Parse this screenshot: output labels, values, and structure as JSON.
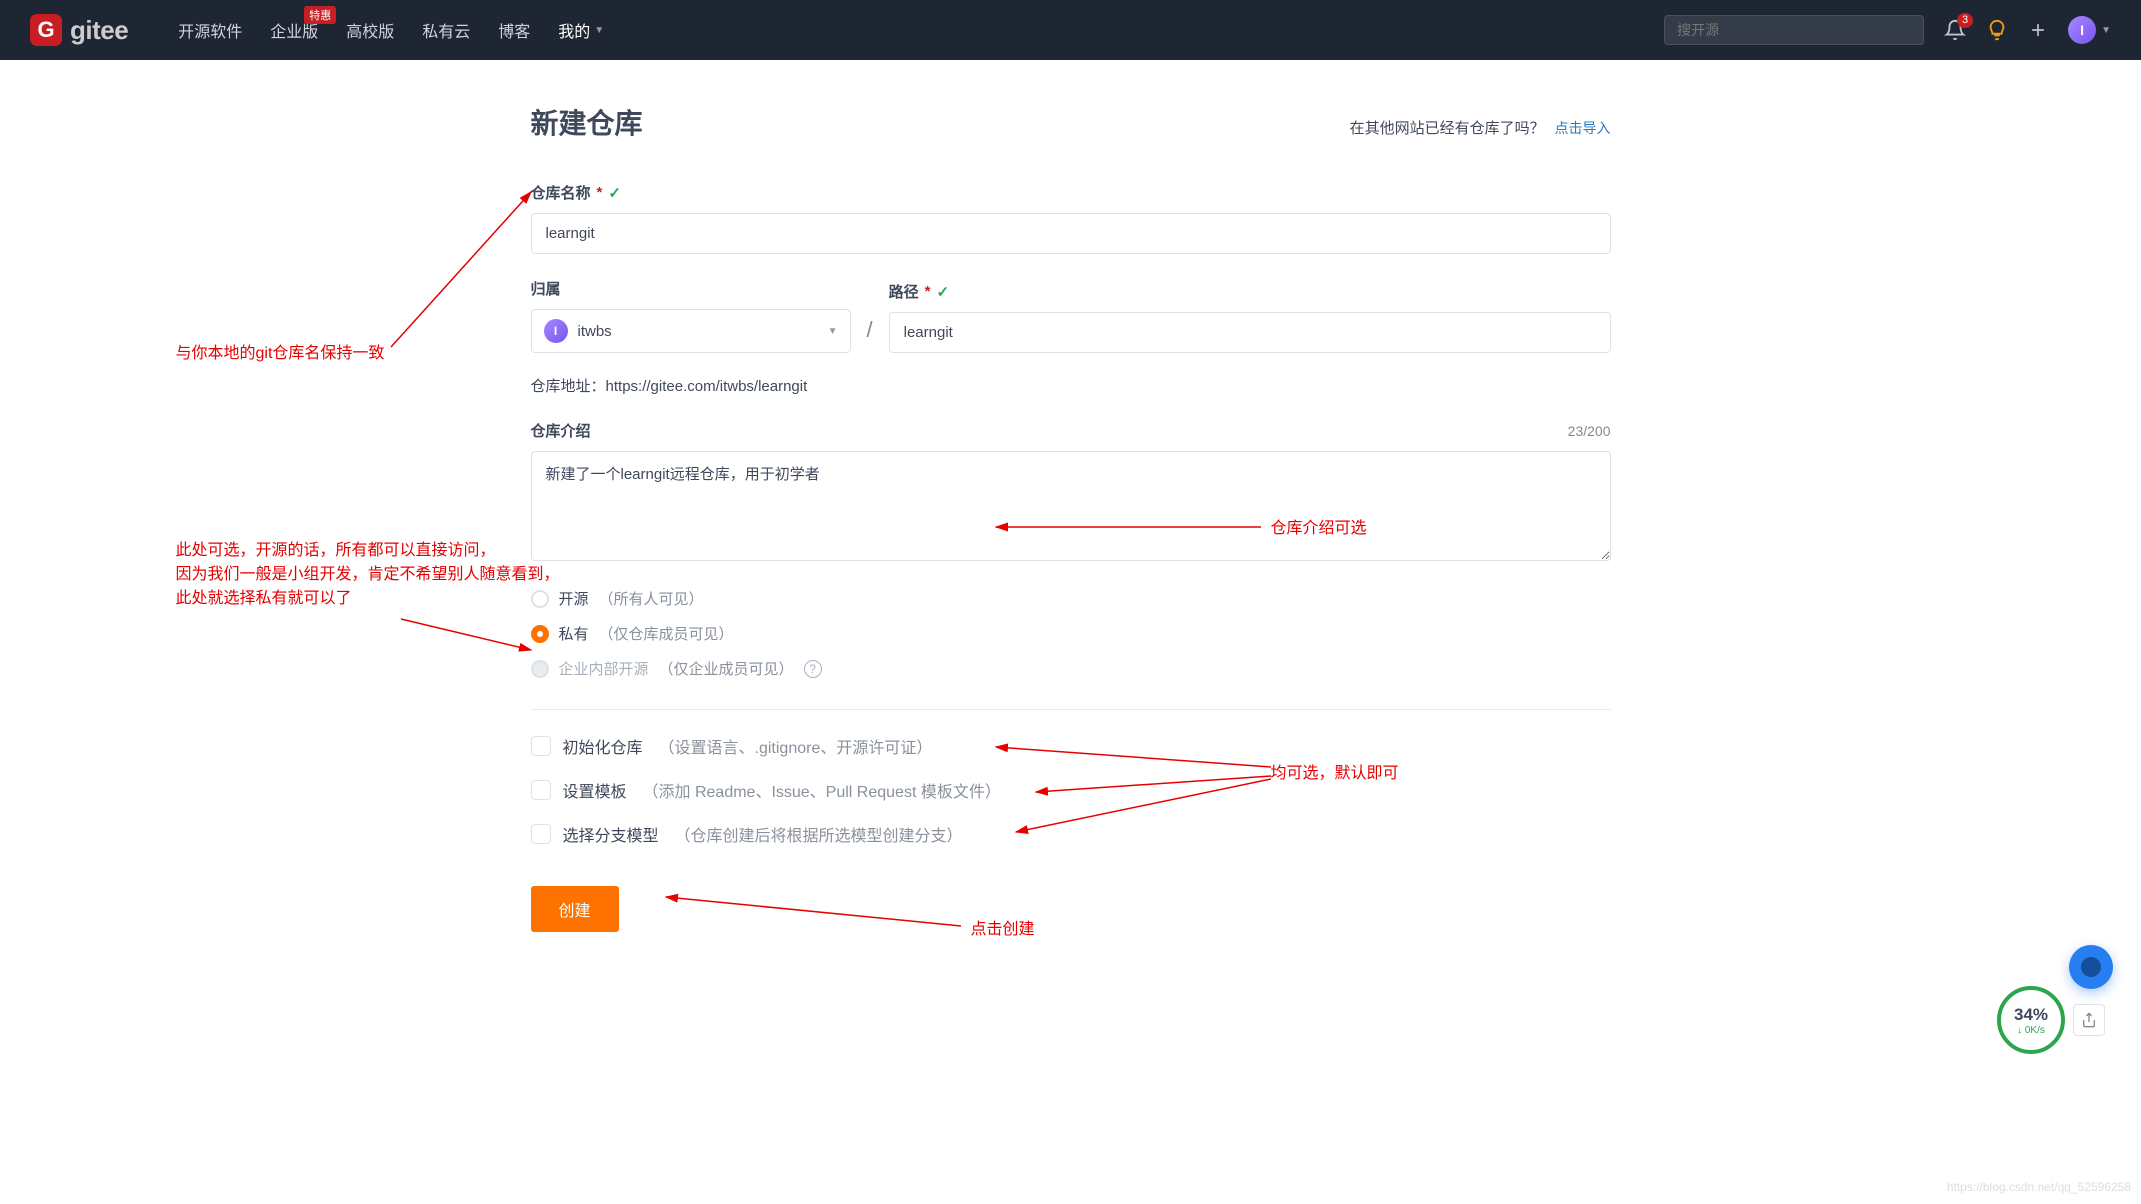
{
  "header": {
    "logo_text": "gitee",
    "nav": {
      "opensource": "开源软件",
      "enterprise": "企业版",
      "enterprise_badge": "特惠",
      "campus": "高校版",
      "private_cloud": "私有云",
      "blog": "博客",
      "mine": "我的"
    },
    "search_placeholder": "搜开源",
    "notif_count": "3",
    "avatar_initial": "I"
  },
  "page": {
    "title": "新建仓库",
    "import_prompt": "在其他网站已经有仓库了吗？",
    "import_link": "点击导入"
  },
  "form": {
    "name_label": "仓库名称",
    "name_value": "learngit",
    "owner_label": "归属",
    "owner_name": "itwbs",
    "owner_avatar_initial": "I",
    "path_label": "路径",
    "path_value": "learngit",
    "url_label": "仓库地址：",
    "url_value": "https://gitee.com/itwbs/learngit",
    "intro_label": "仓库介绍",
    "intro_count": "23/200",
    "intro_value": "新建了一个learngit远程仓库，用于初学者",
    "visibility": {
      "open_label": "开源",
      "open_hint": "（所有人可见）",
      "private_label": "私有",
      "private_hint": "（仅仓库成员可见）",
      "enterprise_label": "企业内部开源",
      "enterprise_hint": "（仅企业成员可见）"
    },
    "init_repo_label": "初始化仓库",
    "init_repo_hint": "（设置语言、.gitignore、开源许可证）",
    "template_label": "设置模板",
    "template_hint": "（添加 Readme、Issue、Pull Request 模板文件）",
    "branch_label": "选择分支模型",
    "branch_hint": "（仓库创建后将根据所选模型创建分支）",
    "submit": "创建"
  },
  "annotations": {
    "a1": "与你本地的git仓库名保持一致",
    "a2_line1": "此处可选，开源的话，所有都可以直接访问，",
    "a2_line2": "因为我们一般是小组开发，肯定不希望别人随意看到，",
    "a2_line3": "此处就选择私有就可以了",
    "a3": "仓库介绍可选",
    "a4": "均可选，默认即可",
    "a5": "点击创建"
  },
  "widget": {
    "pct": "34%",
    "speed": "↓ 0K/s"
  },
  "watermark": "https://blog.csdn.net/qq_52596258"
}
